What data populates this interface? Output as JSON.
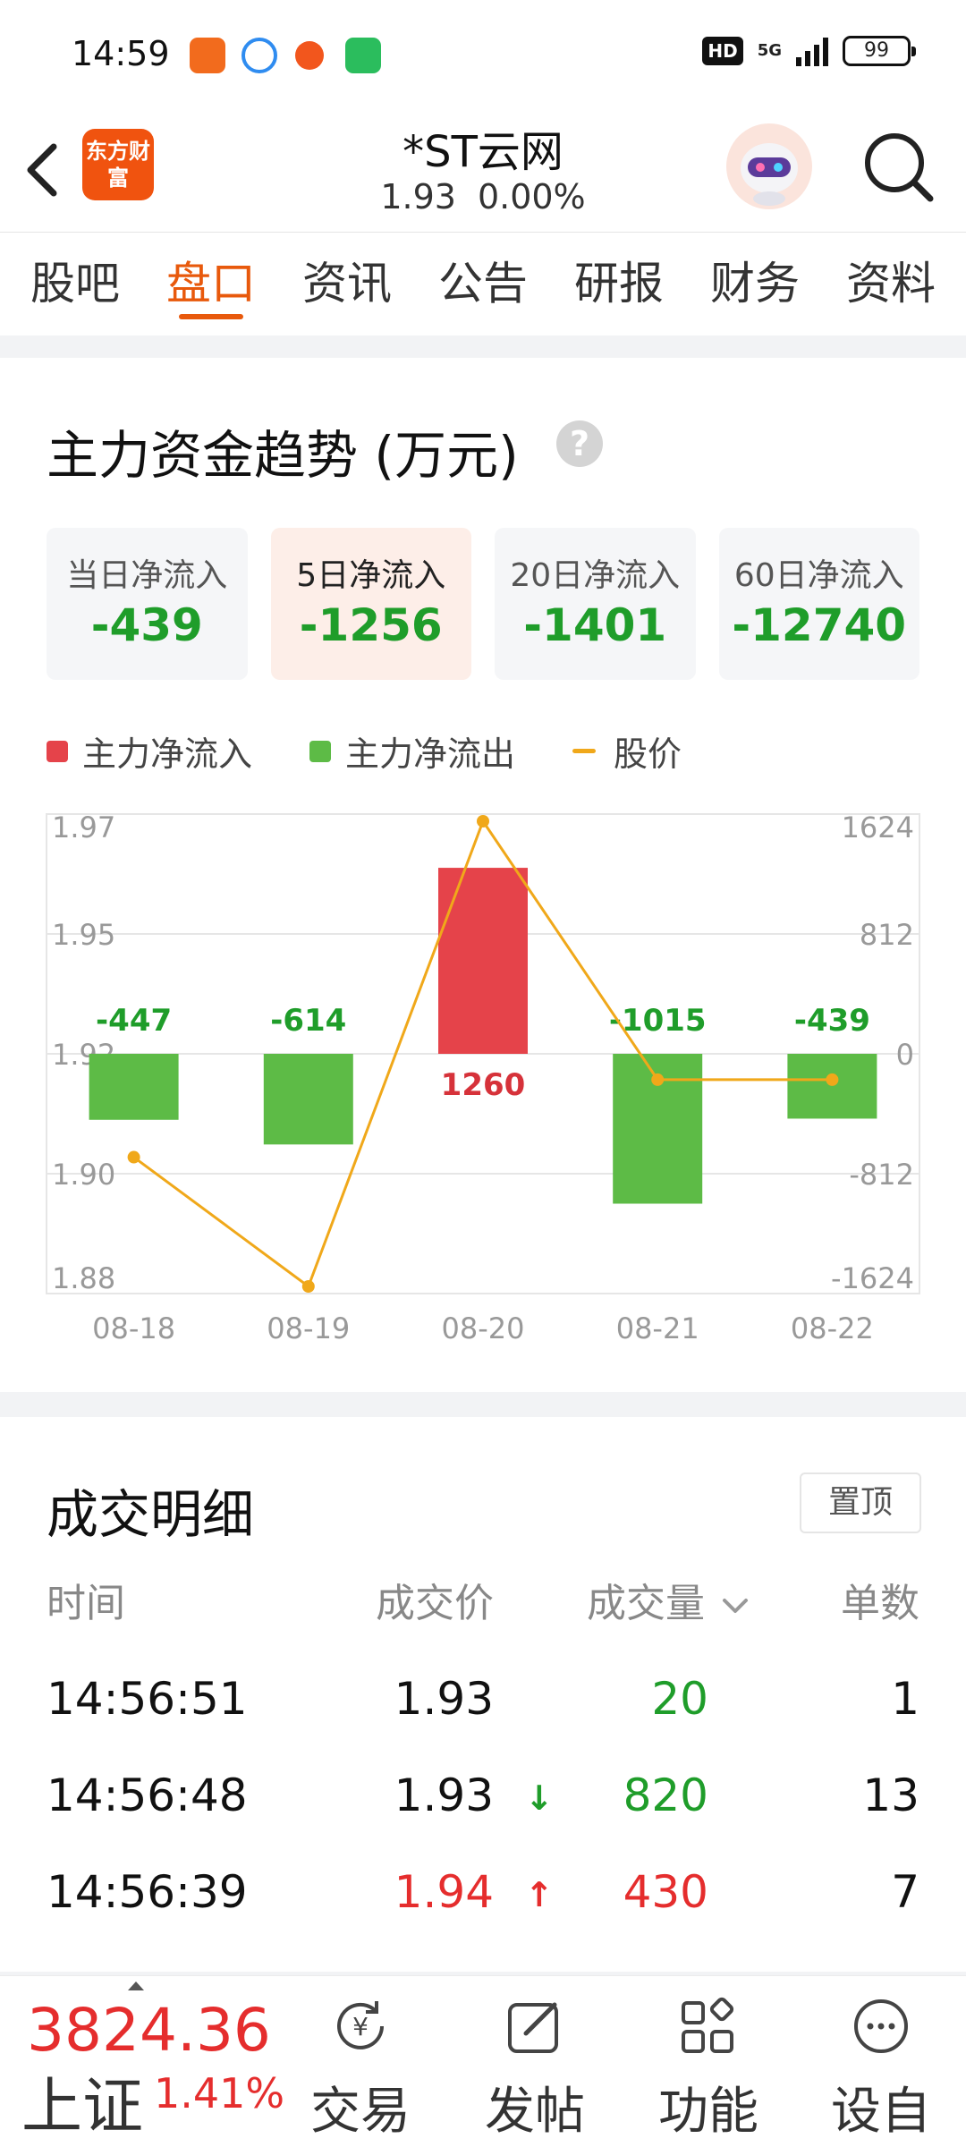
{
  "status_bar": {
    "time": "14:59",
    "hd_label": "HD",
    "network": "5G",
    "battery": "99",
    "app_icon_colors": [
      "#f26b1d",
      "#2f8cf0",
      "#f2561d",
      "#2bbd5d"
    ]
  },
  "header": {
    "brand_logo_text": "东方财富",
    "stock_name": "*ST云网",
    "price": "1.93",
    "change_pct": "0.00%"
  },
  "tabs": [
    {
      "label": "股吧",
      "active": false
    },
    {
      "label": "盘口",
      "active": true
    },
    {
      "label": "资讯",
      "active": false
    },
    {
      "label": "公告",
      "active": false
    },
    {
      "label": "研报",
      "active": false
    },
    {
      "label": "财务",
      "active": false
    },
    {
      "label": "资料",
      "active": false
    }
  ],
  "trend": {
    "title": "主力资金趋势 (万元)",
    "help_glyph": "?",
    "boxes": [
      {
        "label": "当日净流入",
        "value": "-439",
        "active": false
      },
      {
        "label": "5日净流入",
        "value": "-1256",
        "active": true
      },
      {
        "label": "20日净流入",
        "value": "-1401",
        "active": false
      },
      {
        "label": "60日净流入",
        "value": "-12740",
        "active": false
      }
    ],
    "legend": {
      "inflow": "主力净流入",
      "outflow": "主力净流出",
      "price": "股价"
    }
  },
  "chart_data": {
    "type": "bar",
    "categories": [
      "08-18",
      "08-19",
      "08-20",
      "08-21",
      "08-22"
    ],
    "series": [
      {
        "name": "主力净流入 / 主力净流出",
        "values": [
          -447,
          -614,
          1260,
          -1015,
          -439
        ]
      },
      {
        "name": "股价",
        "values": [
          1.905,
          1.88,
          1.97,
          1.92,
          1.92
        ]
      }
    ],
    "y_left_ticks": [
      "1.97",
      "1.95",
      "1.92",
      "1.90",
      "1.88"
    ],
    "y_left_range": [
      1.88,
      1.97
    ],
    "y_right_ticks": [
      "1624",
      "812",
      "0",
      "-812",
      "-1624"
    ],
    "y_right_range": [
      -1624,
      1624
    ],
    "grid": true,
    "colors": {
      "inflow": "#e5434a",
      "outflow": "#5dbb46",
      "price": "#f0a81a"
    }
  },
  "trades": {
    "title": "成交明细",
    "pin_label": "置顶",
    "headers": {
      "time": "时间",
      "price": "成交价",
      "volume": "成交量",
      "count": "单数"
    },
    "rows": [
      {
        "time": "14:56:51",
        "price": "1.93",
        "arrow": "",
        "volume": "20",
        "count": "1",
        "price_color": "#111111",
        "volume_color": "#1f9d2a"
      },
      {
        "time": "14:56:48",
        "price": "1.93",
        "arrow": "↓",
        "arrow_color": "#1f9d2a",
        "volume": "820",
        "count": "13",
        "price_color": "#111111",
        "volume_color": "#1f9d2a"
      },
      {
        "time": "14:56:39",
        "price": "1.94",
        "arrow": "↑",
        "arrow_color": "#e52d2d",
        "volume": "430",
        "count": "7",
        "price_color": "#e52d2d",
        "volume_color": "#e52d2d"
      }
    ]
  },
  "bottom_bar": {
    "index_value": "3824.36",
    "index_name": "上证",
    "index_change": "1.41%",
    "nav": [
      {
        "label": "交易",
        "icon": "trade-icon"
      },
      {
        "label": "发帖",
        "icon": "edit-icon"
      },
      {
        "label": "功能",
        "icon": "apps-icon"
      },
      {
        "label": "设自",
        "icon": "more-icon"
      }
    ]
  }
}
